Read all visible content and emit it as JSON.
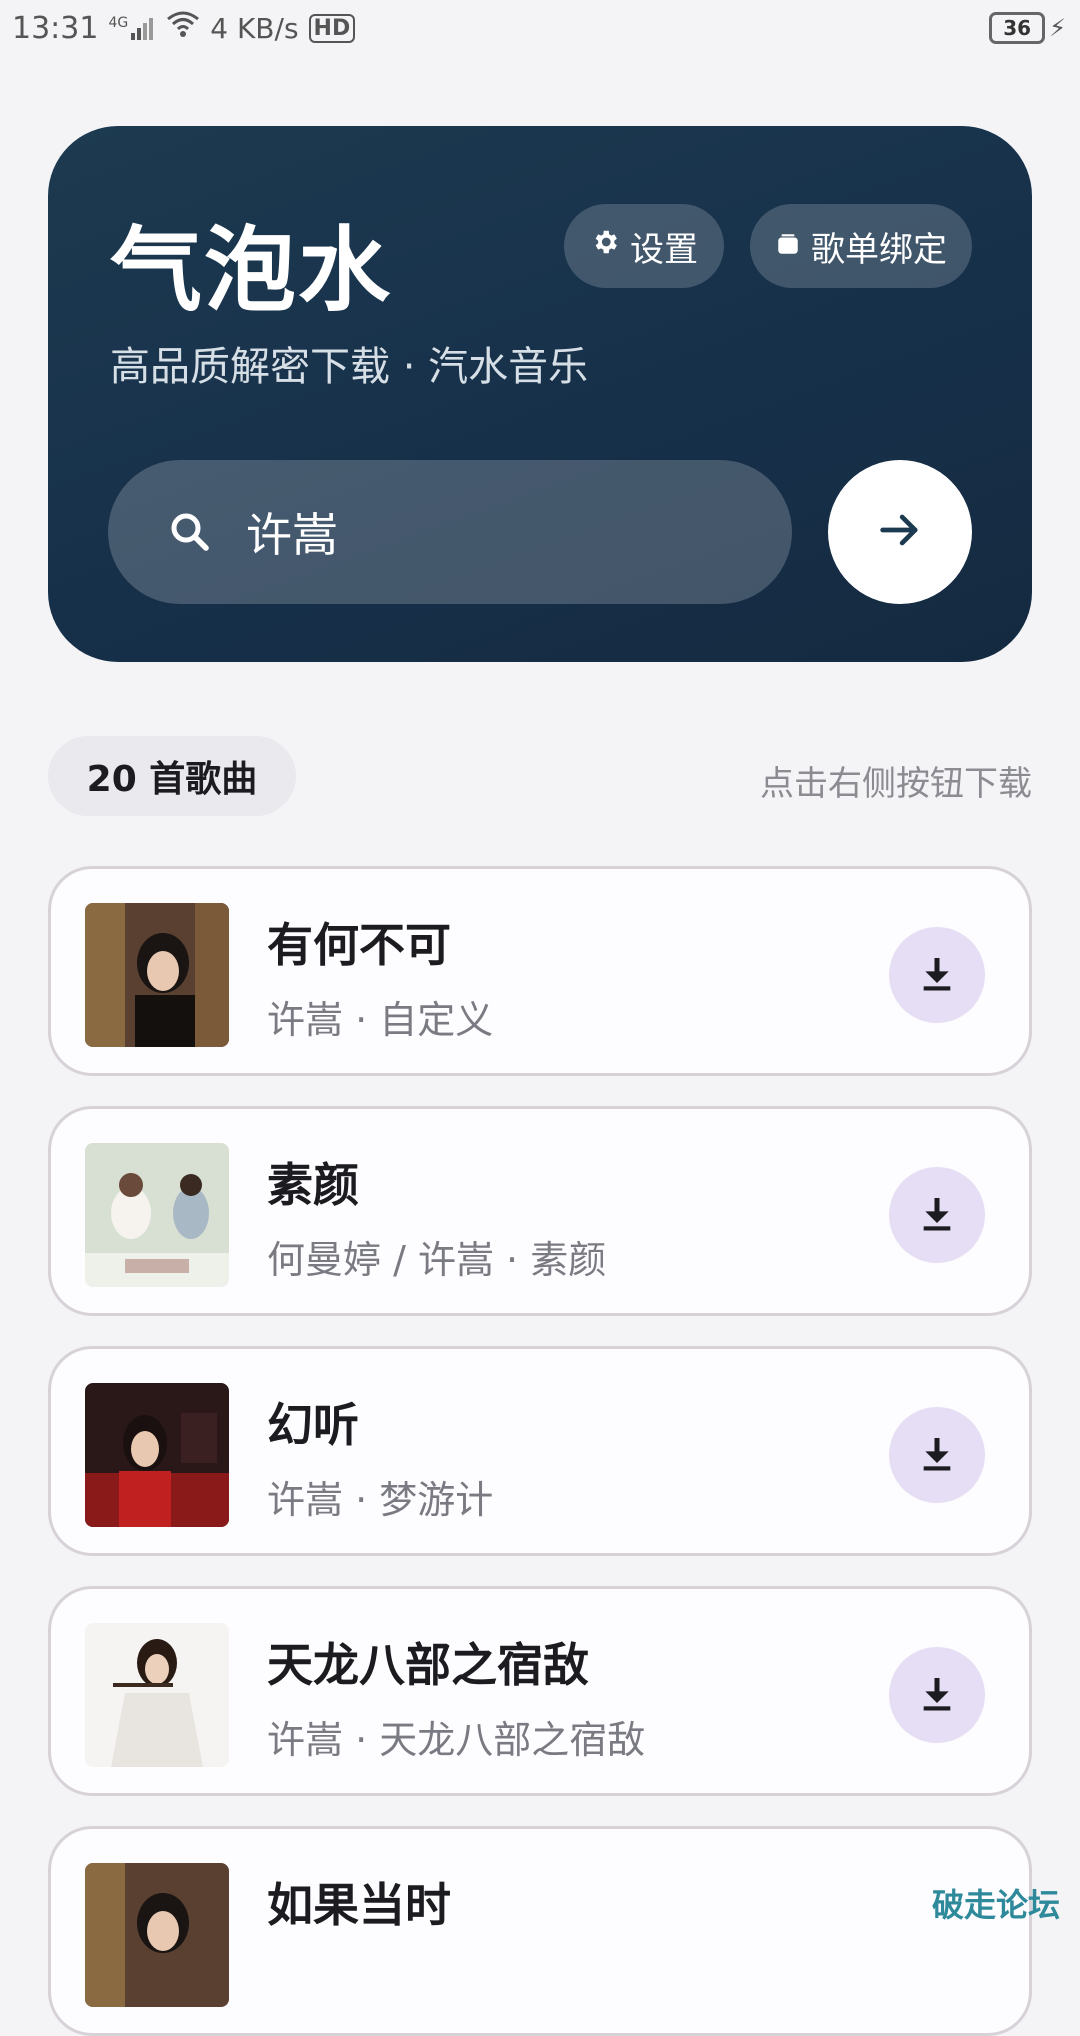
{
  "status": {
    "time": "13:31",
    "network": "4G",
    "speed": "4 KB/s",
    "hd": "HD",
    "battery": "36"
  },
  "header": {
    "title": "气泡水",
    "subtitle": "高品质解密下载 · 汽水音乐",
    "settings_label": "设置",
    "bind_label": "歌单绑定",
    "search_value": "许嵩"
  },
  "list_info": {
    "count_label": "20 首歌曲",
    "hint": "点击右侧按钮下载"
  },
  "songs": [
    {
      "title": "有何不可",
      "meta": "许嵩 · 自定义"
    },
    {
      "title": "素颜",
      "meta": "何曼婷 / 许嵩 · 素颜"
    },
    {
      "title": "幻听",
      "meta": "许嵩 · 梦游计"
    },
    {
      "title": "天龙八部之宿敌",
      "meta": "许嵩 · 天龙八部之宿敌"
    },
    {
      "title": "如果当时",
      "meta": ""
    }
  ],
  "watermark": "破走论坛",
  "colors": {
    "header_bg": "#17304a",
    "accent_button": "#e6def4",
    "page_bg": "#f4f4f6"
  }
}
